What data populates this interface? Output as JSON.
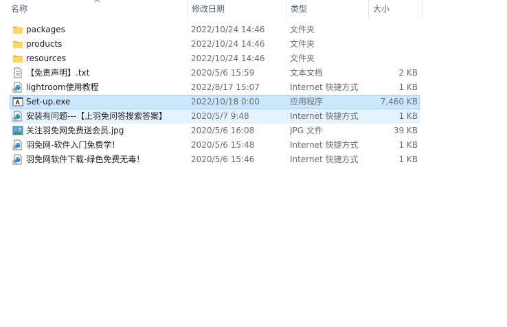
{
  "columns": {
    "name": "名称",
    "date": "修改日期",
    "type": "类型",
    "size": "大小"
  },
  "files": [
    {
      "name": "packages",
      "date": "2022/10/24 14:46",
      "type": "文件夹",
      "size": "",
      "icon": "folder-icon",
      "state": ""
    },
    {
      "name": "products",
      "date": "2022/10/24 14:46",
      "type": "文件夹",
      "size": "",
      "icon": "folder-icon",
      "state": ""
    },
    {
      "name": "resources",
      "date": "2022/10/24 14:46",
      "type": "文件夹",
      "size": "",
      "icon": "folder-icon",
      "state": ""
    },
    {
      "name": "【免责声明】.txt",
      "date": "2020/5/6 15:59",
      "type": "文本文档",
      "size": "2 KB",
      "icon": "text-file-icon",
      "state": ""
    },
    {
      "name": "lightroom使用教程",
      "date": "2022/8/17 15:07",
      "type": "Internet 快捷方式",
      "size": "1 KB",
      "icon": "internet-shortcut-icon",
      "state": ""
    },
    {
      "name": "Set-up.exe",
      "date": "2022/10/18 0:00",
      "type": "应用程序",
      "size": "7,460 KB",
      "icon": "adobe-installer-icon",
      "state": "selected"
    },
    {
      "name": "安装有问题---【上羽免问答搜索答案】",
      "date": "2020/5/7 9:48",
      "type": "Internet 快捷方式",
      "size": "1 KB",
      "icon": "internet-shortcut-icon",
      "state": "hover"
    },
    {
      "name": "关注羽免网免费送会员.jpg",
      "date": "2020/5/6 16:08",
      "type": "JPG 文件",
      "size": "39 KB",
      "icon": "image-file-icon",
      "state": ""
    },
    {
      "name": "羽免网-软件入门免费学！",
      "date": "2020/5/6 15:48",
      "type": "Internet 快捷方式",
      "size": "1 KB",
      "icon": "internet-shortcut-icon",
      "state": ""
    },
    {
      "name": "羽免网软件下载-绿色免费无毒！",
      "date": "2020/5/6 15:46",
      "type": "Internet 快捷方式",
      "size": "1 KB",
      "icon": "internet-shortcut-icon",
      "state": ""
    }
  ]
}
